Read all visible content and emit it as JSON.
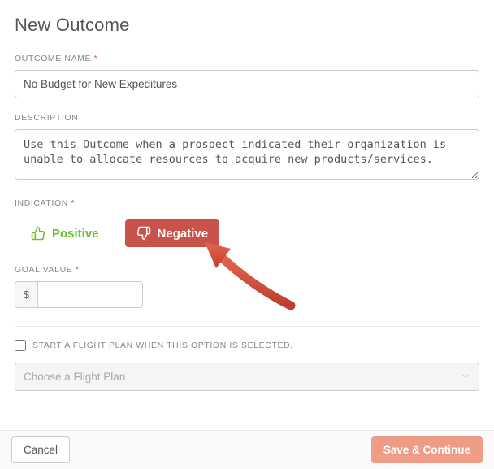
{
  "page_title": "New Outcome",
  "labels": {
    "outcome_name": "OUTCOME NAME",
    "description": "DESCRIPTION",
    "indication": "INDICATION",
    "goal_value": "GOAL VALUE",
    "required_marker": "*"
  },
  "fields": {
    "outcome_name_value": "No Budget for New Expeditures",
    "description_value": "Use this Outcome when a prospect indicated their organization is unable to allocate resources to acquire new products/services.",
    "goal_currency_symbol": "$",
    "goal_value": ""
  },
  "indication": {
    "positive_label": "Positive",
    "negative_label": "Negative",
    "selected": "negative"
  },
  "flight_plan": {
    "checkbox_label": "START A FLIGHT PLAN WHEN THIS OPTION IS SELECTED.",
    "checked": false,
    "select_placeholder": "Choose a Flight Plan"
  },
  "footer": {
    "cancel_label": "Cancel",
    "save_label": "Save & Continue"
  },
  "colors": {
    "positive": "#6fbf2a",
    "negative_bg": "#c9534a",
    "save_bg": "#ef9c86",
    "arrow": "#d14c3a"
  }
}
